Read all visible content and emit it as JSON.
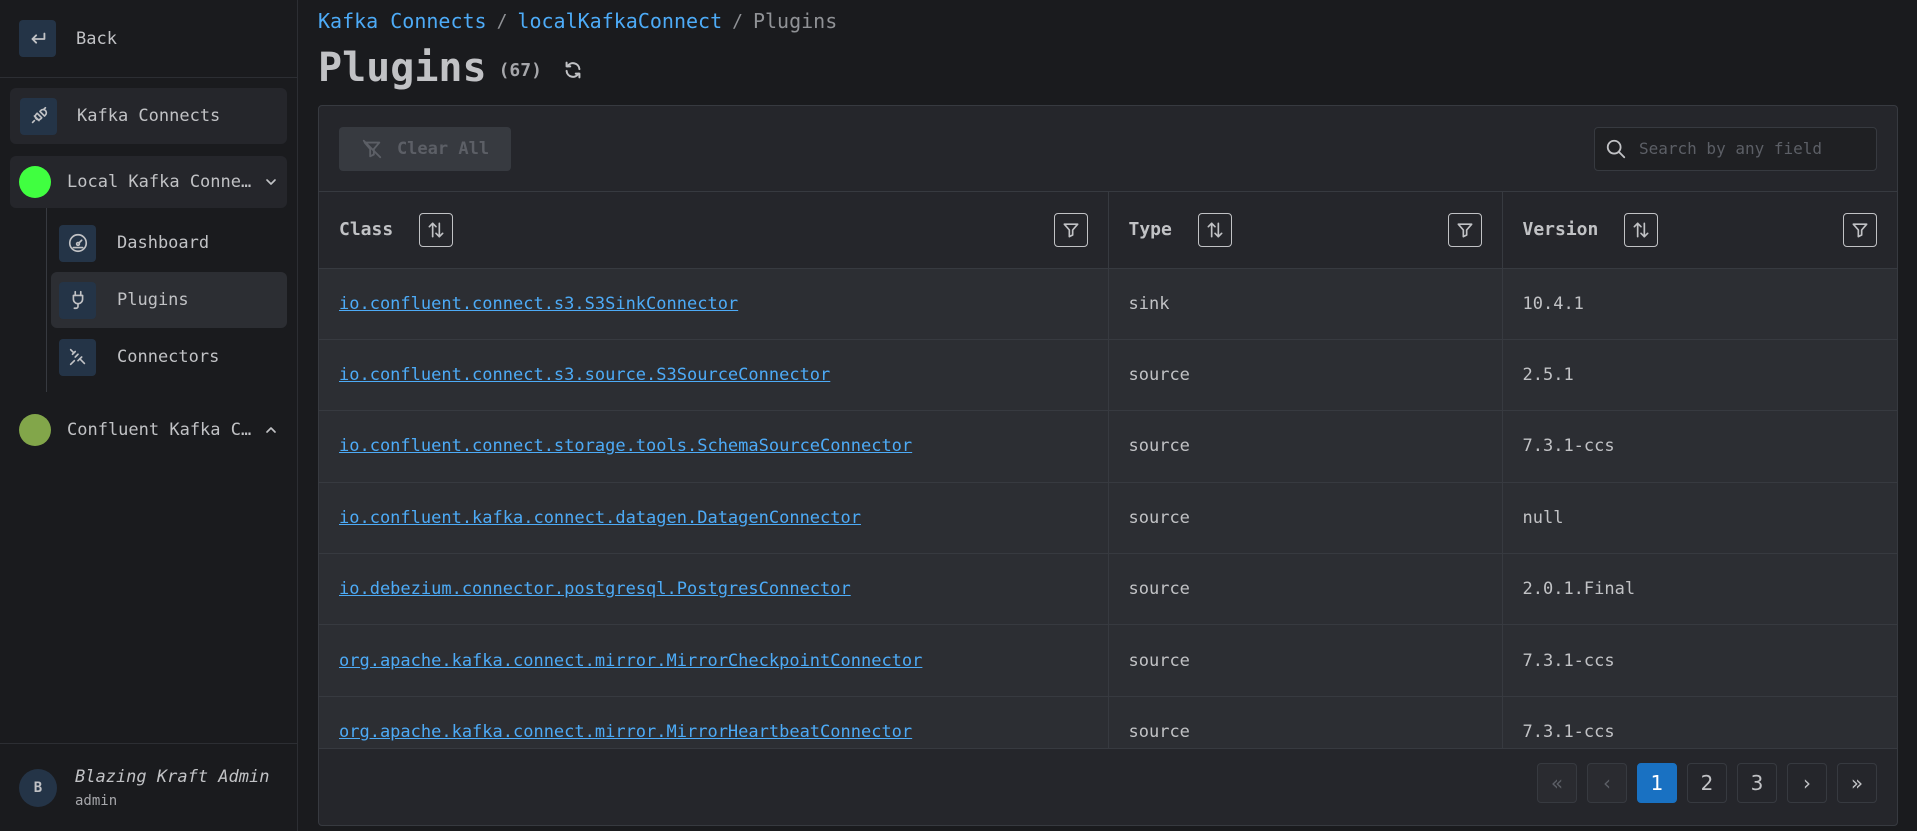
{
  "sidebar": {
    "back_label": "Back",
    "kafka_connects_label": "Kafka Connects",
    "connections": [
      {
        "label": "Local Kafka Connect",
        "color": "#40ff40"
      },
      {
        "label": "Confluent Kafka Connect",
        "color": "#82a64a"
      }
    ],
    "subnav": [
      {
        "label": "Dashboard",
        "icon": "dashboard-gauge-icon"
      },
      {
        "label": "Plugins",
        "icon": "plug-icon"
      },
      {
        "label": "Connectors",
        "icon": "connectors-icon"
      }
    ],
    "user": {
      "initial": "B",
      "name": "Blazing Kraft Admin",
      "role": "admin"
    }
  },
  "breadcrumb": {
    "items": [
      "Kafka Connects",
      "localKafkaConnect"
    ],
    "separator": "/",
    "current": "Plugins"
  },
  "page": {
    "title": "Plugins",
    "count": "(67)"
  },
  "toolbar": {
    "clear_all": "Clear All",
    "search_placeholder": "Search by any field"
  },
  "table": {
    "columns": [
      "Class",
      "Type",
      "Version"
    ],
    "rows": [
      [
        "io.confluent.connect.s3.S3SinkConnector",
        "sink",
        "10.4.1"
      ],
      [
        "io.confluent.connect.s3.source.S3SourceConnector",
        "source",
        "2.5.1"
      ],
      [
        "io.confluent.connect.storage.tools.SchemaSourceConnector",
        "source",
        "7.3.1-ccs"
      ],
      [
        "io.confluent.kafka.connect.datagen.DatagenConnector",
        "source",
        "null"
      ],
      [
        "io.debezium.connector.postgresql.PostgresConnector",
        "source",
        "2.0.1.Final"
      ],
      [
        "org.apache.kafka.connect.mirror.MirrorCheckpointConnector",
        "source",
        "7.3.1-ccs"
      ],
      [
        "org.apache.kafka.connect.mirror.MirrorHeartbeatConnector",
        "source",
        "7.3.1-ccs"
      ]
    ]
  },
  "pagination": {
    "first": "«",
    "prev": "‹",
    "pages": [
      "1",
      "2",
      "3"
    ],
    "current": "1",
    "next": "›",
    "last": "»"
  }
}
